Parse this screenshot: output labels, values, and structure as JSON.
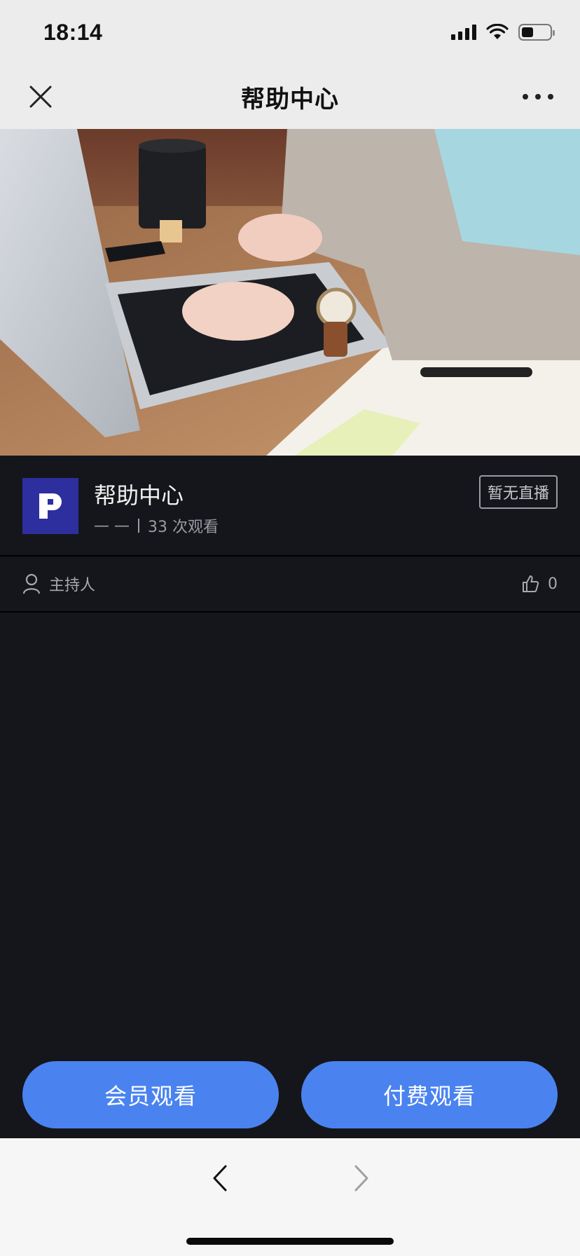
{
  "status_bar": {
    "time": "18:14"
  },
  "nav": {
    "title": "帮助中心"
  },
  "room": {
    "logo_letter": "P",
    "title": "帮助中心",
    "meta_dashes": "— —",
    "views": "33 次观看",
    "live_status": "暂无直播"
  },
  "host": {
    "label": "主持人",
    "likes": "0"
  },
  "actions": {
    "member_watch": "会员观看",
    "paid_watch": "付费观看"
  },
  "colors": {
    "accent": "#4a83f0",
    "dark_bg": "#15161b",
    "logo_bg": "#2d2f9e"
  }
}
